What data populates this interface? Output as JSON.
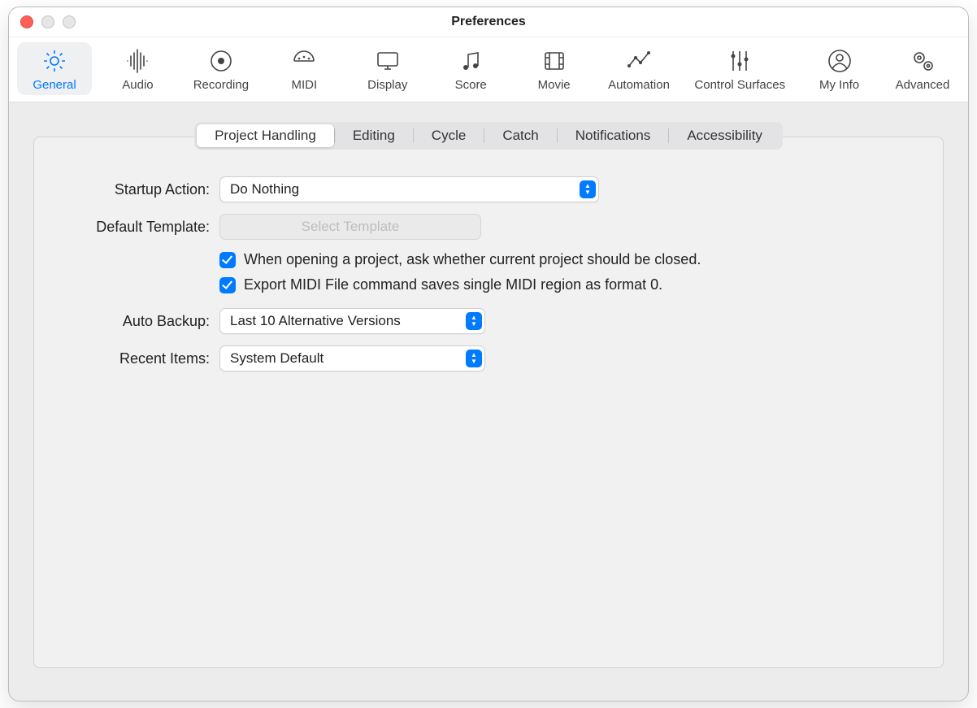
{
  "window": {
    "title": "Preferences"
  },
  "toolbar": {
    "items": [
      {
        "label": "General"
      },
      {
        "label": "Audio"
      },
      {
        "label": "Recording"
      },
      {
        "label": "MIDI"
      },
      {
        "label": "Display"
      },
      {
        "label": "Score"
      },
      {
        "label": "Movie"
      },
      {
        "label": "Automation"
      },
      {
        "label": "Control Surfaces"
      },
      {
        "label": "My Info"
      },
      {
        "label": "Advanced"
      }
    ]
  },
  "segments": {
    "items": [
      {
        "label": "Project Handling"
      },
      {
        "label": "Editing"
      },
      {
        "label": "Cycle"
      },
      {
        "label": "Catch"
      },
      {
        "label": "Notifications"
      },
      {
        "label": "Accessibility"
      }
    ]
  },
  "form": {
    "startup_label": "Startup Action:",
    "startup_value": "Do Nothing",
    "template_label": "Default Template:",
    "template_button": "Select Template",
    "check1": "When opening a project, ask whether current project should be closed.",
    "check2": "Export MIDI File command saves single MIDI region as format 0.",
    "backup_label": "Auto Backup:",
    "backup_value": "Last 10 Alternative Versions",
    "recent_label": "Recent Items:",
    "recent_value": "System Default"
  }
}
